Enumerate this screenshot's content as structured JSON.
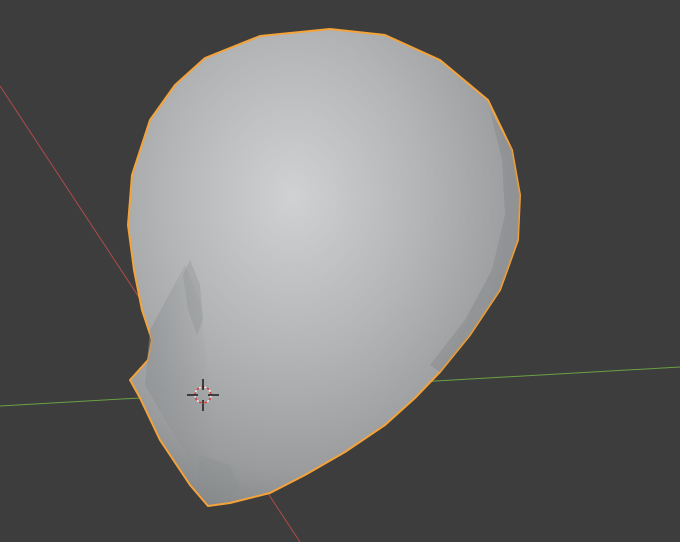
{
  "viewport": {
    "background_color": "#3d3d3d",
    "x_axis_color": "#b04a4a",
    "y_axis_color": "#6aa142",
    "selection_outline_color": "#f4a23a",
    "mesh_base_color": "#a9abad",
    "mesh_highlight_color": "#cfd1d3",
    "mesh_shadow_color": "#7e8183"
  },
  "scene": {
    "selected_object": "head-mesh",
    "cursor_icon": "3d-cursor-icon"
  }
}
